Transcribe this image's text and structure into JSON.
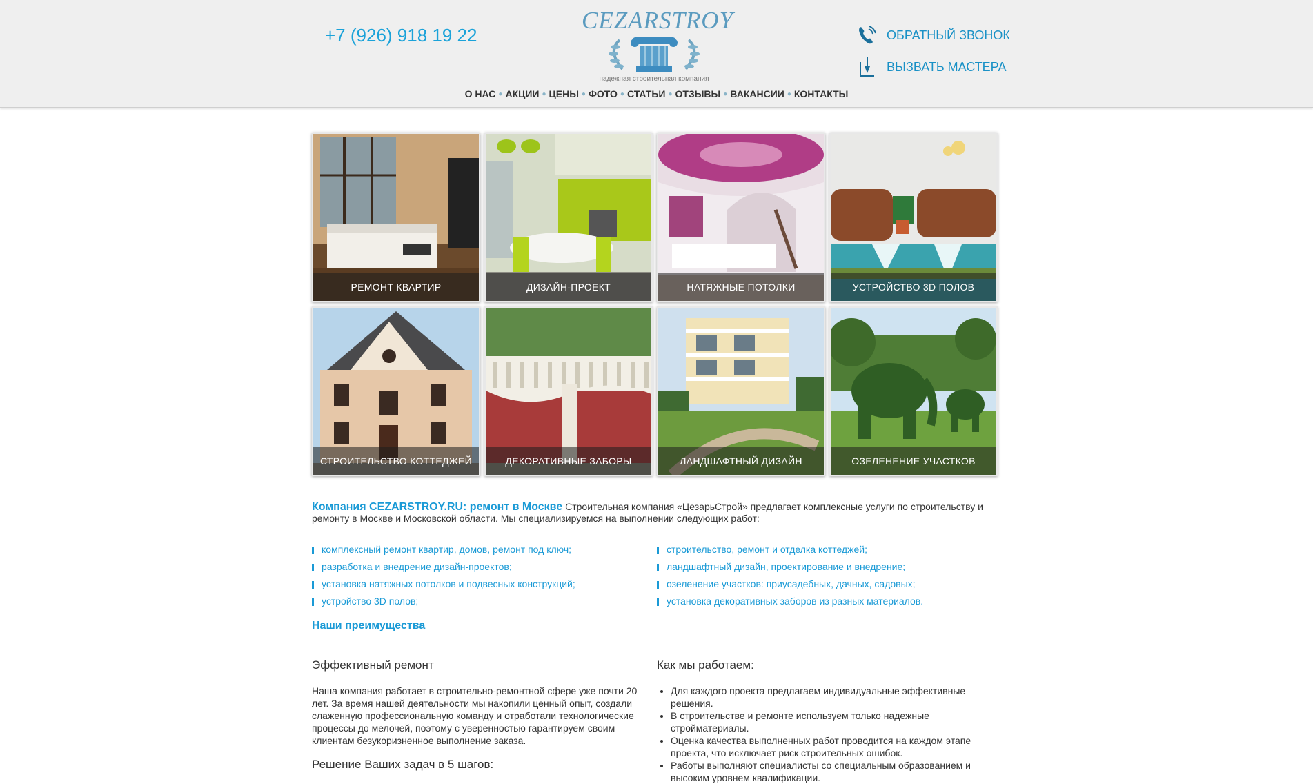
{
  "header": {
    "phone": "+7 (926) 918 19 22",
    "logo_text": "CEZARSTROY",
    "logo_tagline": "надежная строительная компания",
    "callback_label": "ОБРАТНЫЙ ЗВОНОК",
    "master_label": "ВЫЗВАТЬ МАСТЕРА"
  },
  "nav": {
    "items": [
      "О НАС",
      "АКЦИИ",
      "ЦЕНЫ",
      "ФОТО",
      "СТАТЬИ",
      "ОТЗЫВЫ",
      "ВАКАНСИИ",
      "КОНТАКТЫ"
    ]
  },
  "tiles": [
    {
      "caption": "РЕМОНТ КВАРТИР"
    },
    {
      "caption": "ДИЗАЙН-ПРОЕКТ"
    },
    {
      "caption": "НАТЯЖНЫЕ ПОТОЛКИ"
    },
    {
      "caption": "УСТРОЙСТВО 3D ПОЛОВ"
    },
    {
      "caption": "СТРОИТЕЛЬСТВО КОТТЕДЖЕЙ"
    },
    {
      "caption": "ДЕКОРАТИВНЫЕ ЗАБОРЫ"
    },
    {
      "caption": "ЛАНДШАФТНЫЙ ДИЗАЙН"
    },
    {
      "caption": "ОЗЕЛЕНЕНИЕ УЧАСТКОВ"
    }
  ],
  "intro": {
    "lead": "Компания CEZARSTROY.RU: ремонт в Москве",
    "text": " Строительная компания «ЦезарьСтрой» предлагает комплексные услуги по строительству и ремонту в Москве и Московской области. Мы специализируемся на выполнении следующих работ:"
  },
  "services_left": [
    "комплексный ремонт квартир, домов, ремонт под ключ;",
    "разработка и внедрение дизайн-проектов;",
    "установка натяжных потолков и подвесных конструкций;",
    "устройство 3D полов;"
  ],
  "services_right": [
    "строительство, ремонт и отделка коттеджей;",
    "ландшафтный дизайн, проектирование и внедрение;",
    "озеленение участков: приусадебных, дачных, садовых;",
    "установка декоративных заборов из разных материалов."
  ],
  "advantages_title": "Наши преимущества",
  "effective": {
    "title": "Эффективный ремонт",
    "text": "Наша компания работает в строительно-ремонтной сфере уже почти 20 лет. За время нашей деятельности мы накопили ценный опыт, создали слаженную профессиональную команду и отработали технологические процессы до мелочей, поэтому с уверенностью гарантируем своим клиентам безукоризненное выполнение заказа."
  },
  "steps_title": "Решение Ваших задач в 5 шагов:",
  "how": {
    "title": "Как мы работаем:",
    "items": [
      "Для каждого проекта предлагаем индивидуальные эффективные решения.",
      "В строительстве и ремонте используем только надежные стройматериалы.",
      "Оценка качества выполненных работ проводится на каждом этапе проекта, что исключает риск  строительных ошибок.",
      "Работы выполняют специалисты со специальным образованием и высоким уровнем квалификации."
    ]
  },
  "colors": {
    "accent": "#1a9ad6",
    "header_bg": "#efefef"
  }
}
